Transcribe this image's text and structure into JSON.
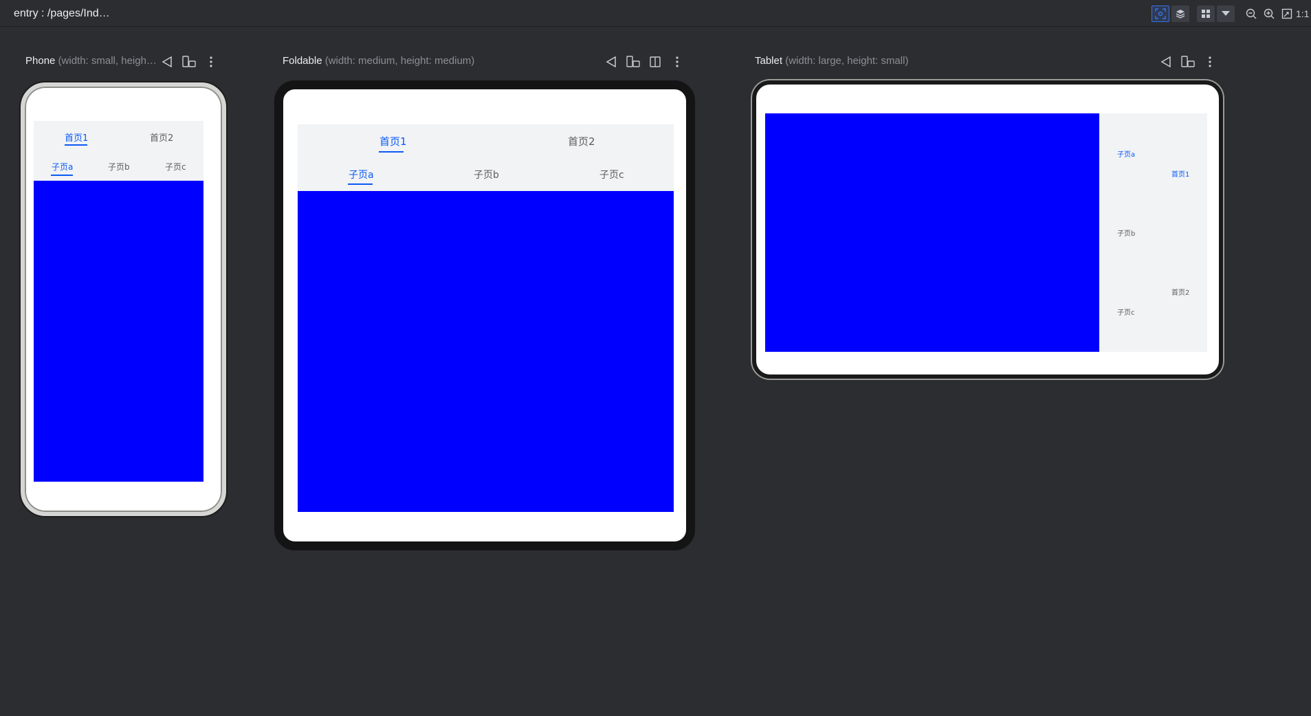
{
  "topbar": {
    "title": "entry : /pages/Ind…",
    "icons": [
      "preview-icon",
      "layers-icon",
      "grid-icon",
      "chevron-down-icon",
      "zoom-out-icon",
      "zoom-in-icon",
      "fit-screen-icon"
    ],
    "ratio_label": "1:1"
  },
  "devices": {
    "phone": {
      "name": "Phone",
      "dims": " (width: small, heigh…",
      "tabs": [
        "首页1",
        "首页2"
      ],
      "subtabs": [
        "子页a",
        "子页b",
        "子页c"
      ]
    },
    "foldable": {
      "name": "Foldable",
      "dims": " (width: medium, height: medium)",
      "tabs": [
        "首页1",
        "首页2"
      ],
      "subtabs": [
        "子页a",
        "子页b",
        "子页c"
      ]
    },
    "tablet": {
      "name": "Tablet",
      "dims": " (width: large, height: small)",
      "tabs": [
        "首页1",
        "首页2"
      ],
      "subtabs": [
        "子页a",
        "子页b",
        "子页c"
      ]
    }
  },
  "colors": {
    "accent": "#0a59f7",
    "content": "#0000ff",
    "tabbar": "#f1f3f5",
    "background": "#2b2d31"
  }
}
